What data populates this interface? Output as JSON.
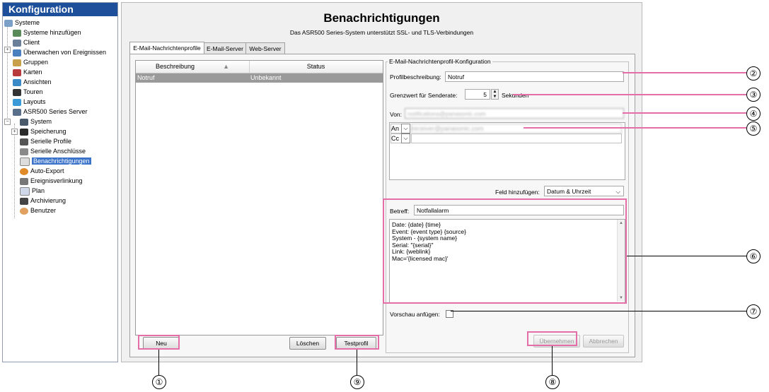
{
  "tree": {
    "title": "Konfiguration",
    "items": [
      {
        "label": "Systeme"
      },
      {
        "label": "Systeme hinzufügen"
      },
      {
        "label": "Client"
      },
      {
        "label": "Überwachen von Ereignissen"
      },
      {
        "label": "Gruppen"
      },
      {
        "label": "Karten"
      },
      {
        "label": "Ansichten"
      },
      {
        "label": "Touren"
      },
      {
        "label": "Layouts"
      },
      {
        "label": "ASR500 Series Server"
      },
      {
        "label": "System"
      },
      {
        "label": "Speicherung"
      },
      {
        "label": "Serielle Profile"
      },
      {
        "label": "Serielle Anschlüsse"
      },
      {
        "label": "Benachrichtigungen"
      },
      {
        "label": "Auto-Export"
      },
      {
        "label": "Ereignisverlinkung"
      },
      {
        "label": "Plan"
      },
      {
        "label": "Archivierung"
      },
      {
        "label": "Benutzer"
      }
    ]
  },
  "header": {
    "title": "Benachrichtigungen",
    "subtitle": "Das ASR500 Series-System unterstützt SSL- und TLS-Verbindungen"
  },
  "tabs": [
    "E-Mail-Nachrichtenprofile",
    "E-Mail-Server",
    "Web-Server"
  ],
  "profiles_table": {
    "columns": [
      "Beschreibung",
      "Status"
    ],
    "rows": [
      {
        "beschreibung": "Notruf",
        "status": "Unbekannt"
      }
    ]
  },
  "left_buttons": {
    "neu": "Neu",
    "loeschen": "Löschen",
    "testprofil": "Testprofil"
  },
  "config": {
    "group_title": "E-Mail-Nachrichtenprofil-Konfiguration",
    "profil_label": "Profilbeschreibung:",
    "profil_value": "Notruf",
    "rate_label": "Grenzwert für Senderate:",
    "rate_value": "5",
    "rate_unit": "Sekunden",
    "von_label": "Von:",
    "von_value": "notifications@panasonic.com",
    "an_label": "An",
    "an_value": "receiver@panasonic.com",
    "cc_label": "Cc",
    "feld_label": "Feld hinzufügen:",
    "feld_value": "Datum & Uhrzeit",
    "betreff_label": "Betreff:",
    "betreff_value": "Notfallalarm",
    "body_lines": [
      "Date: {date} {time}",
      "Event: {event type} {source}",
      "System - {system name}",
      "Serial: \"{serial}\"",
      "Link: {weblink}",
      "Mac='{licensed mac}'"
    ],
    "vorschau_label": "Vorschau anfügen:",
    "uebernehmen": "Übernehmen",
    "abbrechen": "Abbrechen"
  },
  "callouts": [
    "①",
    "②",
    "③",
    "④",
    "⑤",
    "⑥",
    "⑦",
    "⑧",
    "⑨"
  ],
  "colors": {
    "highlight": "#e46fa8",
    "tree_header": "#1d4f9b",
    "selection": "#3a73c9",
    "row_selected": "#9a9a9a"
  }
}
